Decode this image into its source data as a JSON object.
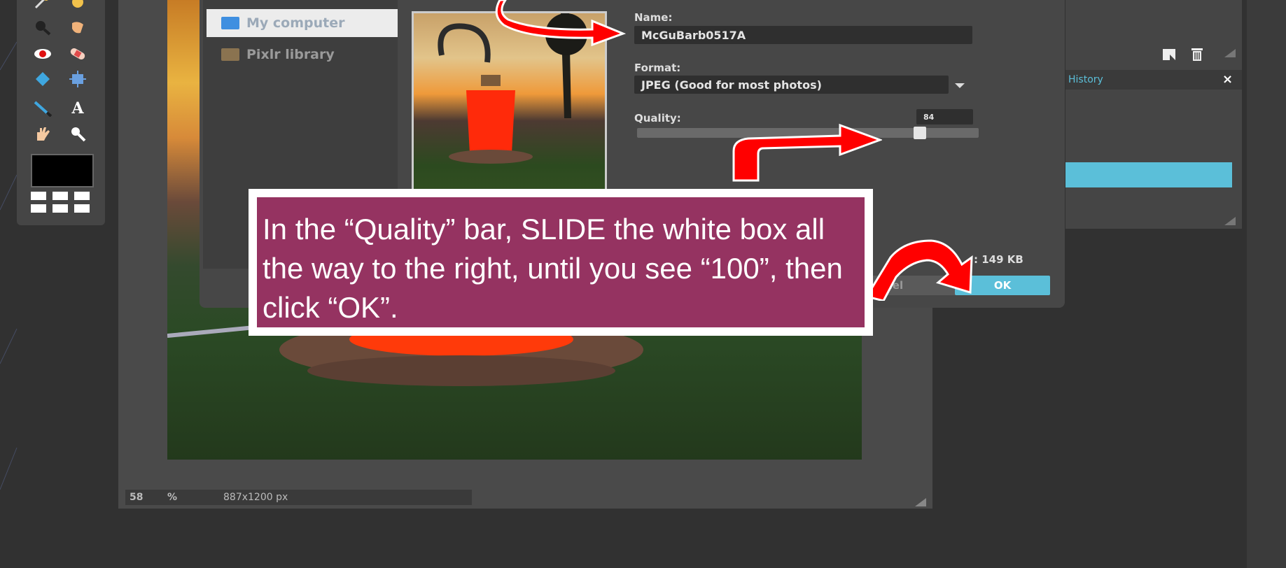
{
  "canvas": {
    "zoom_value": "58",
    "zoom_unit": "%",
    "dimensions": "887x1200 px"
  },
  "save_dialog": {
    "sources": [
      {
        "label": "My computer",
        "icon": "monitor-icon"
      },
      {
        "label": "Pixlr library",
        "icon": "library-icon"
      }
    ],
    "name_label": "Name:",
    "name_value": "McGuBarb0517A",
    "format_label": "Format:",
    "format_value": "JPEG (Good for most photos)",
    "quality_label": "Quality:",
    "quality_value": "84",
    "quality_fraction": 0.84,
    "filesize_text": ": 149 KB",
    "cancel_label": "cel",
    "ok_label": "OK"
  },
  "panels": {
    "history_tab": "History",
    "close_glyph": "×"
  },
  "callout": {
    "text": "In the “Quality” bar, SLIDE the white box all the way to the right, until you see “100”, then click “OK”."
  },
  "colors": {
    "accent": "#5bbfd9",
    "callout_bg": "#953361",
    "arrow": "#ff0000"
  }
}
